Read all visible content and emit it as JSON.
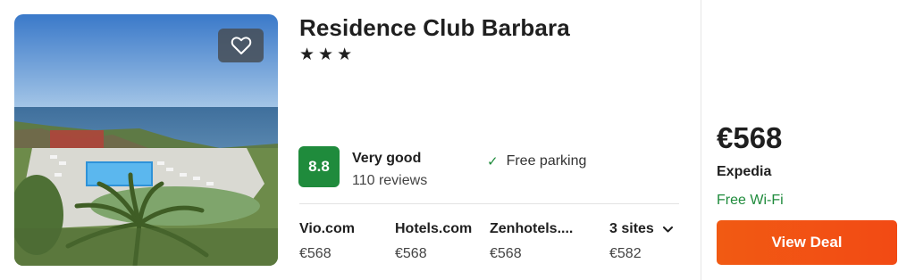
{
  "hotel": {
    "name": "Residence Club Barbara",
    "stars": "★★★",
    "rating_score": "8.8",
    "rating_label": "Very good",
    "review_count": "110 reviews",
    "amenity": "Free parking"
  },
  "sites": [
    {
      "name": "Vio.com",
      "price": "€568"
    },
    {
      "name": "Hotels.com",
      "price": "€568"
    },
    {
      "name": "Zenhotels....",
      "price": "€568"
    },
    {
      "name": "3 sites",
      "price": "€582"
    }
  ],
  "deal": {
    "price": "€568",
    "provider": "Expedia",
    "perk": "Free Wi-Fi",
    "button_label": "View Deal"
  },
  "colors": {
    "rating_green": "#1f8b3c",
    "deal_orange": "#f15a13"
  },
  "icons": {
    "favorite": "heart-icon",
    "check": "check-icon",
    "expand": "chevron-down-icon"
  }
}
